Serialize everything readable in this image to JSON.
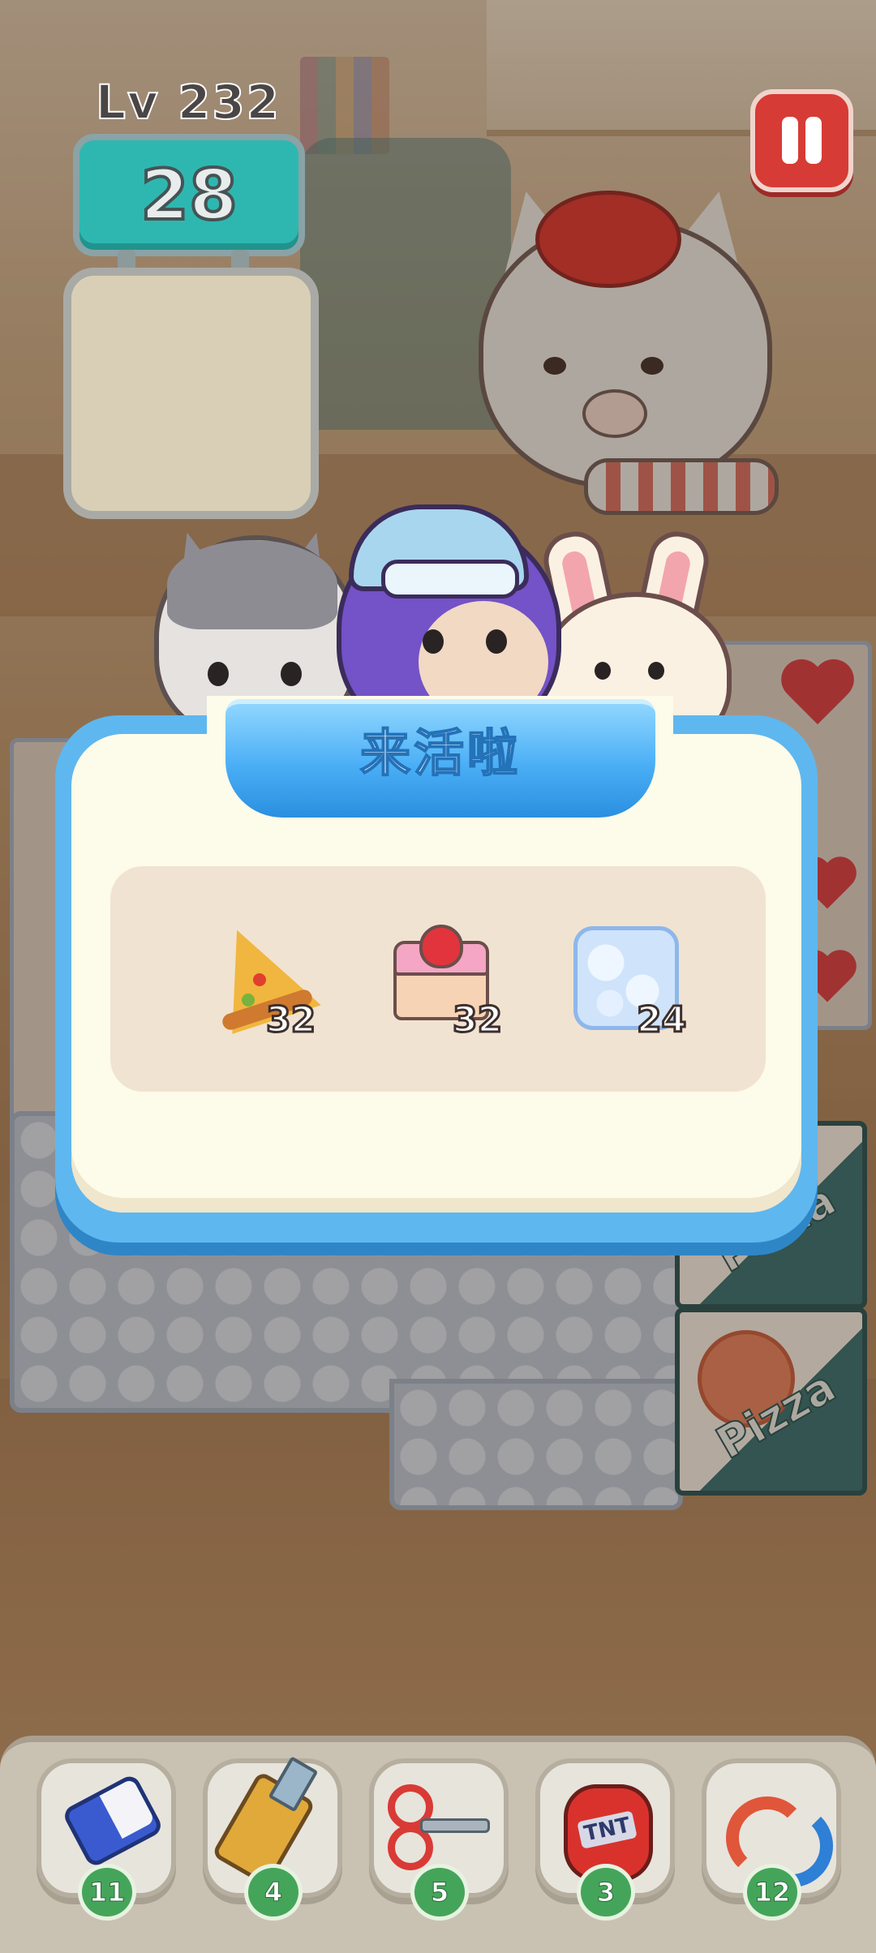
{
  "hud": {
    "level_label": "Lv 232",
    "moves_left": "28",
    "pause_icon": "pause-icon"
  },
  "dialog": {
    "title": "来活啦",
    "goals": [
      {
        "icon": "pizza-slice-icon",
        "count": "32"
      },
      {
        "icon": "strawberry-cake-icon",
        "count": "32"
      },
      {
        "icon": "bubble-block-icon",
        "count": "24"
      }
    ]
  },
  "board": {
    "tile_types": [
      "cake",
      "heart",
      "pizza-box",
      "bubble"
    ],
    "pizza_box_label": "Pizza"
  },
  "toolbar": {
    "tools": [
      {
        "icon": "eraser-icon",
        "count": "11"
      },
      {
        "icon": "knife-icon",
        "count": "4"
      },
      {
        "icon": "scissors-icon",
        "count": "5"
      },
      {
        "icon": "tnt-icon",
        "count": "3"
      },
      {
        "icon": "shuffle-icon",
        "count": "12"
      }
    ]
  },
  "colors": {
    "accent_blue": "#4aaef5",
    "moves_teal": "#2eb7b0",
    "pause_red": "#d73b35",
    "badge_green": "#44a55a"
  }
}
